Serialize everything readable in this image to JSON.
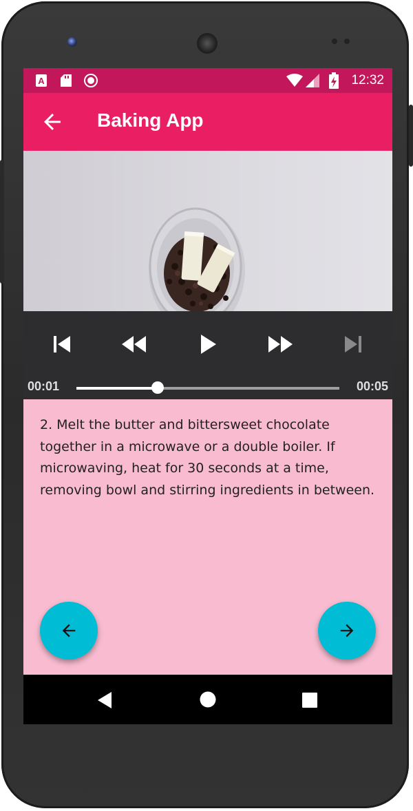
{
  "status_bar": {
    "time": "12:32",
    "icons": [
      "a-notification-icon",
      "sd-card-icon",
      "record-icon",
      "wifi-icon",
      "signal-icon",
      "battery-charging-icon"
    ]
  },
  "app_bar": {
    "title": "Baking App",
    "back_icon": "arrow-back-icon"
  },
  "player": {
    "position": "00:01",
    "duration": "00:05",
    "progress_fraction": 0.31,
    "controls": [
      "skip-previous-icon",
      "rewind-icon",
      "play-icon",
      "fast-forward-icon",
      "skip-next-icon"
    ]
  },
  "step": {
    "description": "2. Melt the butter and bittersweet chocolate together in a microwave or a double boiler. If microwaving, heat for 30 seconds at a time, removing bowl and stirring ingredients in between."
  },
  "navigation": {
    "previous_icon": "arrow-back-icon",
    "next_icon": "arrow-forward-icon"
  },
  "colors": {
    "status_bar": "#c2185b",
    "app_bar": "#e91e63",
    "content_background": "#f8bbd0",
    "fab": "#00bcd4",
    "player_controls": "#2d2d2f"
  }
}
